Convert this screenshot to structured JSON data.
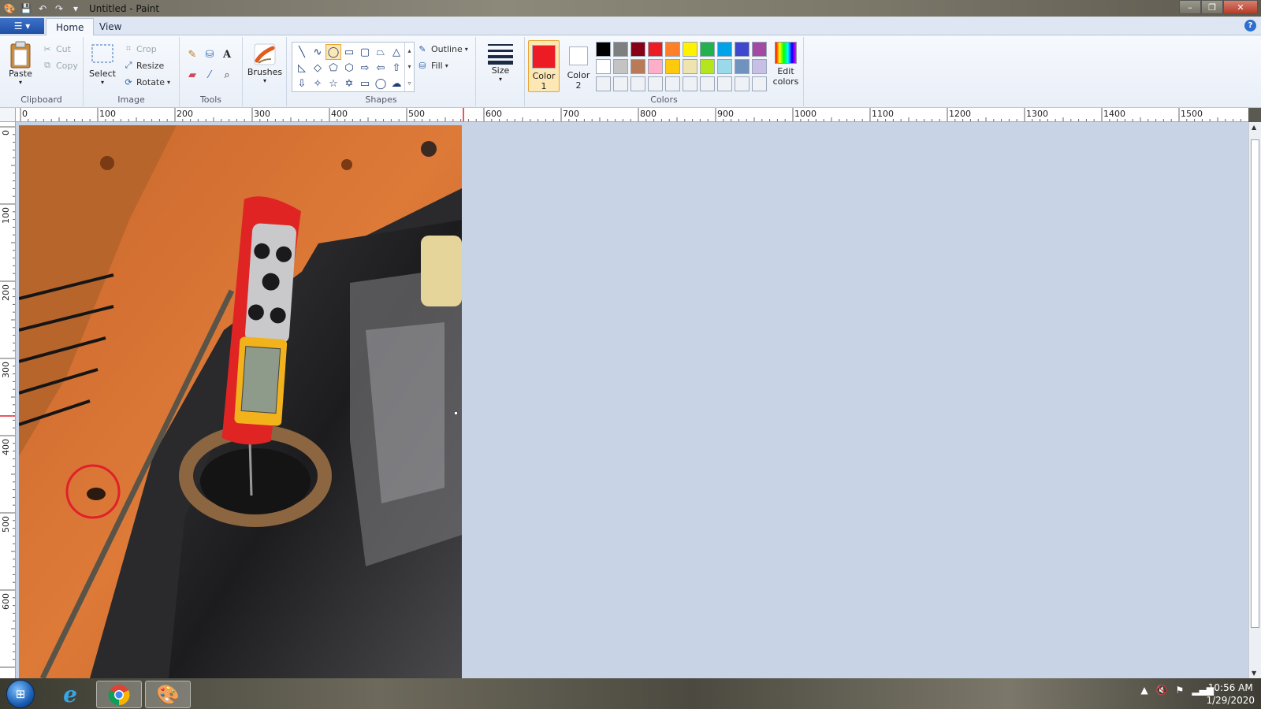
{
  "window": {
    "title": "Untitled - Paint",
    "controls": {
      "minimize": "–",
      "restore": "❐",
      "close": "✕"
    }
  },
  "tabs": {
    "file_label": "☰ ▾",
    "home": "Home",
    "view": "View"
  },
  "ribbon": {
    "clipboard": {
      "label": "Clipboard",
      "paste": "Paste",
      "cut": "Cut",
      "copy": "Copy"
    },
    "image": {
      "label": "Image",
      "select": "Select",
      "crop": "Crop",
      "resize": "Resize",
      "rotate": "Rotate"
    },
    "tools": {
      "label": "Tools"
    },
    "brushes": {
      "label": "Brushes"
    },
    "shapes": {
      "label": "Shapes",
      "outline": "Outline",
      "fill": "Fill"
    },
    "size": {
      "label": "Size"
    },
    "colors": {
      "label": "Colors",
      "color1": "Color\n1",
      "color2": "Color\n2",
      "color1_value": "#ed1c24",
      "color2_value": "#ffffff",
      "edit_colors": "Edit colors",
      "palette_row1": [
        "#000000",
        "#7f7f7f",
        "#880015",
        "#ed1c24",
        "#ff7f27",
        "#fff200",
        "#22b14c",
        "#00a2e8",
        "#3f48cc",
        "#a349a4"
      ],
      "palette_row2": [
        "#ffffff",
        "#c3c3c3",
        "#b97a57",
        "#ffaec9",
        "#ffc90e",
        "#efe4b0",
        "#b5e61d",
        "#99d9ea",
        "#7092be",
        "#c8bfe7"
      ]
    }
  },
  "ruler": {
    "h_labels": [
      "0",
      "100",
      "200",
      "300",
      "400",
      "500",
      "600",
      "700",
      "800",
      "900",
      "1000",
      "1100",
      "1200",
      "1300",
      "1400",
      "1500"
    ],
    "v_labels": [
      "0",
      "100",
      "200",
      "300",
      "400",
      "500",
      "600"
    ]
  },
  "taskbar": {
    "time": "10:56 AM",
    "date": "1/29/2020"
  }
}
